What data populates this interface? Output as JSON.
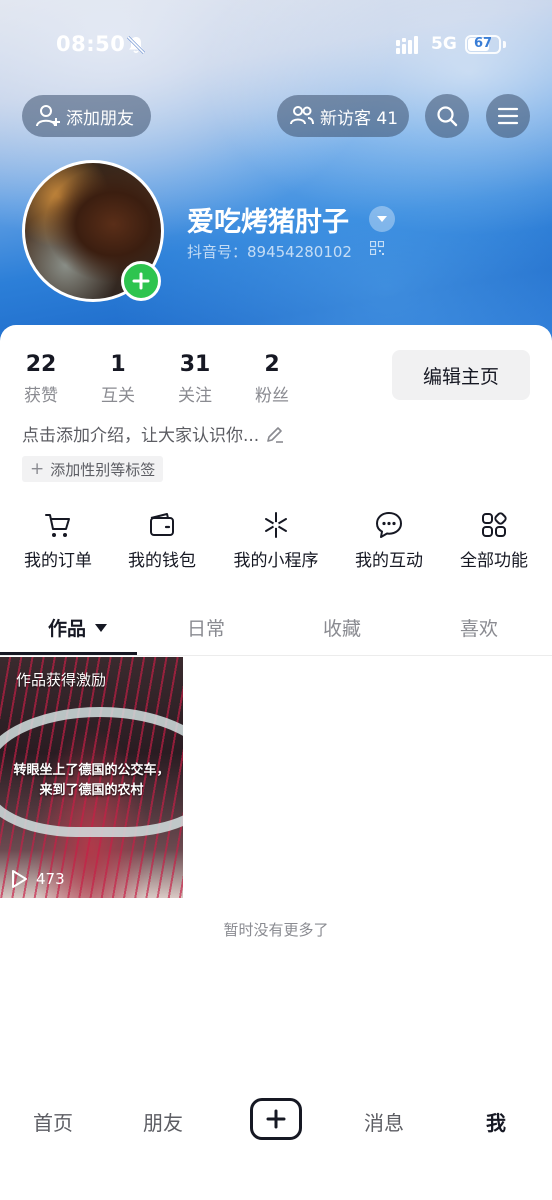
{
  "status_bar": {
    "time": "08:50",
    "network": "5G",
    "battery": "67",
    "battery_level": 0.67
  },
  "header": {
    "add_friend_label": "添加朋友",
    "visitors_label": "新访客 41",
    "nickname": "爱吃烤猪肘子",
    "douyin_id": "抖音号：89454280102"
  },
  "stats": [
    {
      "value": "22",
      "label": "获赞"
    },
    {
      "value": "1",
      "label": "互关"
    },
    {
      "value": "31",
      "label": "关注"
    },
    {
      "value": "2",
      "label": "粉丝"
    }
  ],
  "edit_profile_label": "编辑主页",
  "intro_placeholder": "点击添加介绍，让大家认识你...",
  "tag_button_label": "添加性别等标签",
  "functions": [
    {
      "label": "我的订单",
      "icon": "cart-icon"
    },
    {
      "label": "我的钱包",
      "icon": "wallet-icon"
    },
    {
      "label": "我的小程序",
      "icon": "asterisk-icon"
    },
    {
      "label": "我的互动",
      "icon": "chat-bubble-icon"
    },
    {
      "label": "全部功能",
      "icon": "grid-icon"
    }
  ],
  "tabs": [
    {
      "label": "作品",
      "active": true
    },
    {
      "label": "日常",
      "active": false
    },
    {
      "label": "收藏",
      "active": false
    },
    {
      "label": "喜欢",
      "active": false
    }
  ],
  "video": {
    "badge": "作品获得激励",
    "caption": "转眼坐上了德国的公交车，来到了德国的农村",
    "plays": "473"
  },
  "no_more_text": "暂时没有更多了",
  "bottom_nav": {
    "home": "首页",
    "friends": "朋友",
    "messages": "消息",
    "me": "我"
  }
}
